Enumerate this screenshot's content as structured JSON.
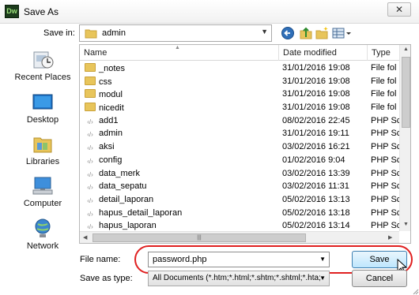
{
  "window": {
    "title": "Save As",
    "app_icon_text": "Dw",
    "close_glyph": "✕"
  },
  "save_in": {
    "label": "Save in:",
    "value": "admin"
  },
  "places": [
    {
      "label": "Recent Places",
      "icon": "recent-places-icon"
    },
    {
      "label": "Desktop",
      "icon": "desktop-icon"
    },
    {
      "label": "Libraries",
      "icon": "libraries-icon"
    },
    {
      "label": "Computer",
      "icon": "computer-icon"
    },
    {
      "label": "Network",
      "icon": "network-icon"
    }
  ],
  "file_list": {
    "columns": {
      "name": "Name",
      "date": "Date modified",
      "type": "Type"
    },
    "sort_glyph": "▲",
    "rows": [
      {
        "name": "_notes",
        "date": "31/01/2016 19:08",
        "type": "File fol",
        "kind": "folder"
      },
      {
        "name": "css",
        "date": "31/01/2016 19:08",
        "type": "File fol",
        "kind": "folder"
      },
      {
        "name": "modul",
        "date": "31/01/2016 19:08",
        "type": "File fol",
        "kind": "folder"
      },
      {
        "name": "nicedit",
        "date": "31/01/2016 19:08",
        "type": "File fol",
        "kind": "folder"
      },
      {
        "name": "add1",
        "date": "08/02/2016 22:45",
        "type": "PHP Sc",
        "kind": "php"
      },
      {
        "name": "admin",
        "date": "31/01/2016 19:11",
        "type": "PHP Sc",
        "kind": "php"
      },
      {
        "name": "aksi",
        "date": "03/02/2016 16:21",
        "type": "PHP Sc",
        "kind": "php"
      },
      {
        "name": "config",
        "date": "01/02/2016 9:04",
        "type": "PHP Sc",
        "kind": "php"
      },
      {
        "name": "data_merk",
        "date": "03/02/2016 13:39",
        "type": "PHP Sc",
        "kind": "php"
      },
      {
        "name": "data_sepatu",
        "date": "03/02/2016 11:31",
        "type": "PHP Sc",
        "kind": "php"
      },
      {
        "name": "detail_laporan",
        "date": "05/02/2016 13:13",
        "type": "PHP Sc",
        "kind": "php"
      },
      {
        "name": "hapus_detail_laporan",
        "date": "05/02/2016 13:18",
        "type": "PHP Sc",
        "kind": "php"
      },
      {
        "name": "hapus_laporan",
        "date": "05/02/2016 13:14",
        "type": "PHP Sc",
        "kind": "php"
      }
    ],
    "hscroll_grip": "|||"
  },
  "form": {
    "file_name_label": "File name:",
    "file_name_value": "password.php",
    "save_type_label": "Save as type:",
    "save_type_value": "All Documents (*.htm;*.html;*.shtm;*.shtml;*.hta;",
    "save_button": "Save",
    "cancel_button": "Cancel"
  },
  "colors": {
    "highlight_ring": "#e02020",
    "save_button_border": "#3c7fb1"
  }
}
